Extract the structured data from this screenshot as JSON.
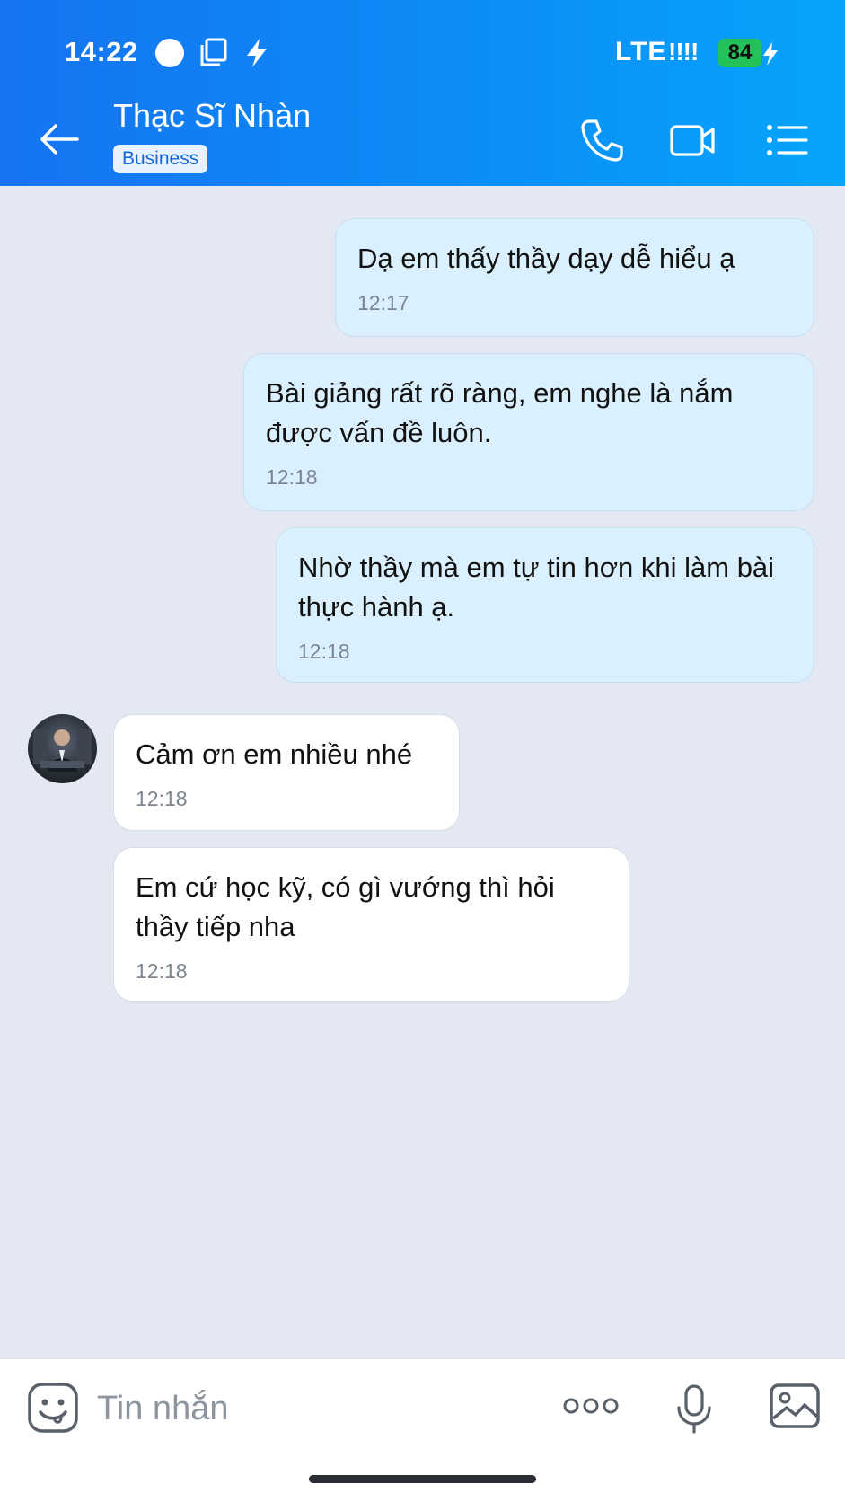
{
  "status_bar": {
    "time": "14:22",
    "network": "LTE",
    "signal": "!!!!",
    "battery": "84",
    "icons": [
      "circle-icon",
      "screen-icon",
      "bolt-icon",
      "battery-charging-icon"
    ]
  },
  "header": {
    "contact_name": "Thạc Sĩ Nhàn",
    "badge": "Business",
    "icons": [
      "back-arrow-icon",
      "phone-icon",
      "video-icon",
      "menu-list-icon"
    ]
  },
  "messages": [
    {
      "side": "sent",
      "text": "Dạ em thấy thầy dạy dễ hiểu ạ",
      "time": "12:17"
    },
    {
      "side": "sent",
      "text": "Bài giảng rất rõ ràng, em nghe là nắm được vấn đề luôn.",
      "time": "12:18"
    },
    {
      "side": "sent",
      "text": "Nhờ thầy mà em tự tin hơn khi làm bài thực hành ạ.",
      "time": "12:18"
    },
    {
      "side": "received",
      "text": "Cảm ơn em nhiều nhé",
      "time": "12:18"
    },
    {
      "side": "received",
      "text": "Em cứ học kỹ, có gì vướng thì hỏi thầy tiếp nha",
      "time": "12:18"
    }
  ],
  "input_bar": {
    "placeholder": "Tin nhắn",
    "icons": [
      "sticker-icon",
      "more-options-icon",
      "microphone-icon",
      "image-icon"
    ]
  },
  "colors": {
    "header_start": "#1574f0",
    "header_end": "#07a4fb",
    "sent_bubble": "#daf0fe",
    "received_bubble": "#ffffff",
    "chat_background": "#e4e8f2",
    "battery": "#23c25a"
  }
}
